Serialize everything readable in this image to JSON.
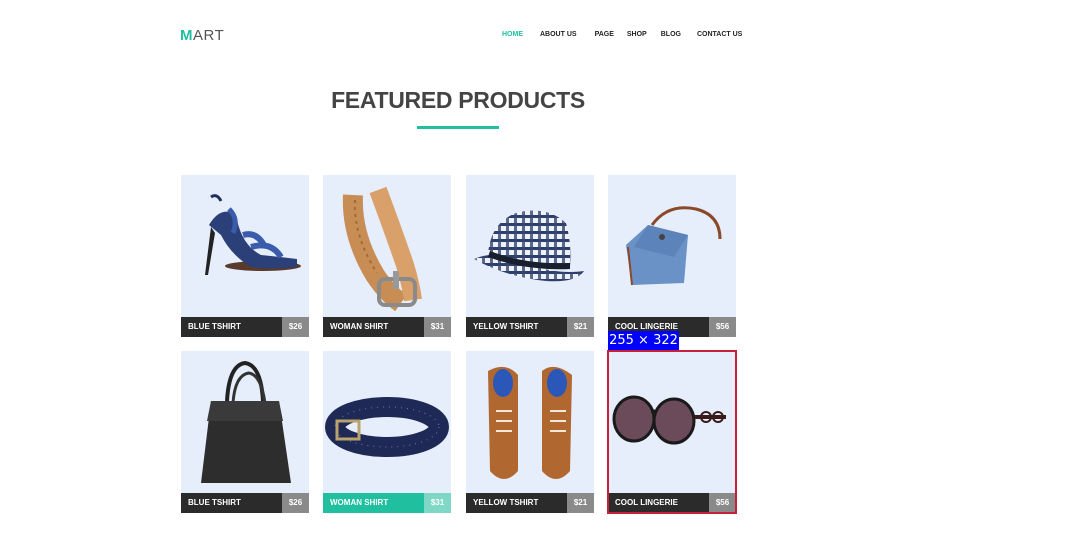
{
  "brand": {
    "first": "M",
    "rest": "ART"
  },
  "nav": [
    {
      "label": "HOME",
      "active": true
    },
    {
      "label": "ABOUT US",
      "active": false
    },
    {
      "label": "PAGE",
      "active": false
    },
    {
      "label": "SHOP",
      "active": false
    },
    {
      "label": "BLOG",
      "active": false
    },
    {
      "label": "CONTACT US",
      "active": false
    }
  ],
  "section": {
    "title": "FEATURED PRODUCTS"
  },
  "products": [
    {
      "name": "BLUE TSHIRT",
      "price": "$26",
      "image": "high-heel-sandal"
    },
    {
      "name": "WOMAN SHIRT",
      "price": "$31",
      "image": "braided-belt"
    },
    {
      "name": "YELLOW TSHIRT",
      "price": "$21",
      "image": "plaid-fedora-hat"
    },
    {
      "name": "COOL LINGERIE",
      "price": "$56",
      "image": "denim-shoulder-bag"
    },
    {
      "name": "BLUE TSHIRT",
      "price": "$26",
      "image": "black-handbag"
    },
    {
      "name": "WOMAN SHIRT",
      "price": "$31",
      "image": "perforated-belt"
    },
    {
      "name": "YELLOW TSHIRT",
      "price": "$21",
      "image": "brown-oxford-shoes"
    },
    {
      "name": "COOL LINGERIE",
      "price": "$56",
      "image": "sunglasses"
    }
  ],
  "overlay": {
    "dimension_label": "255 × 322"
  },
  "colors": {
    "accent": "#1fbf9f",
    "card_bg": "#e6edfb",
    "selection": "#c8203a",
    "label_bg": "#0000ff"
  }
}
